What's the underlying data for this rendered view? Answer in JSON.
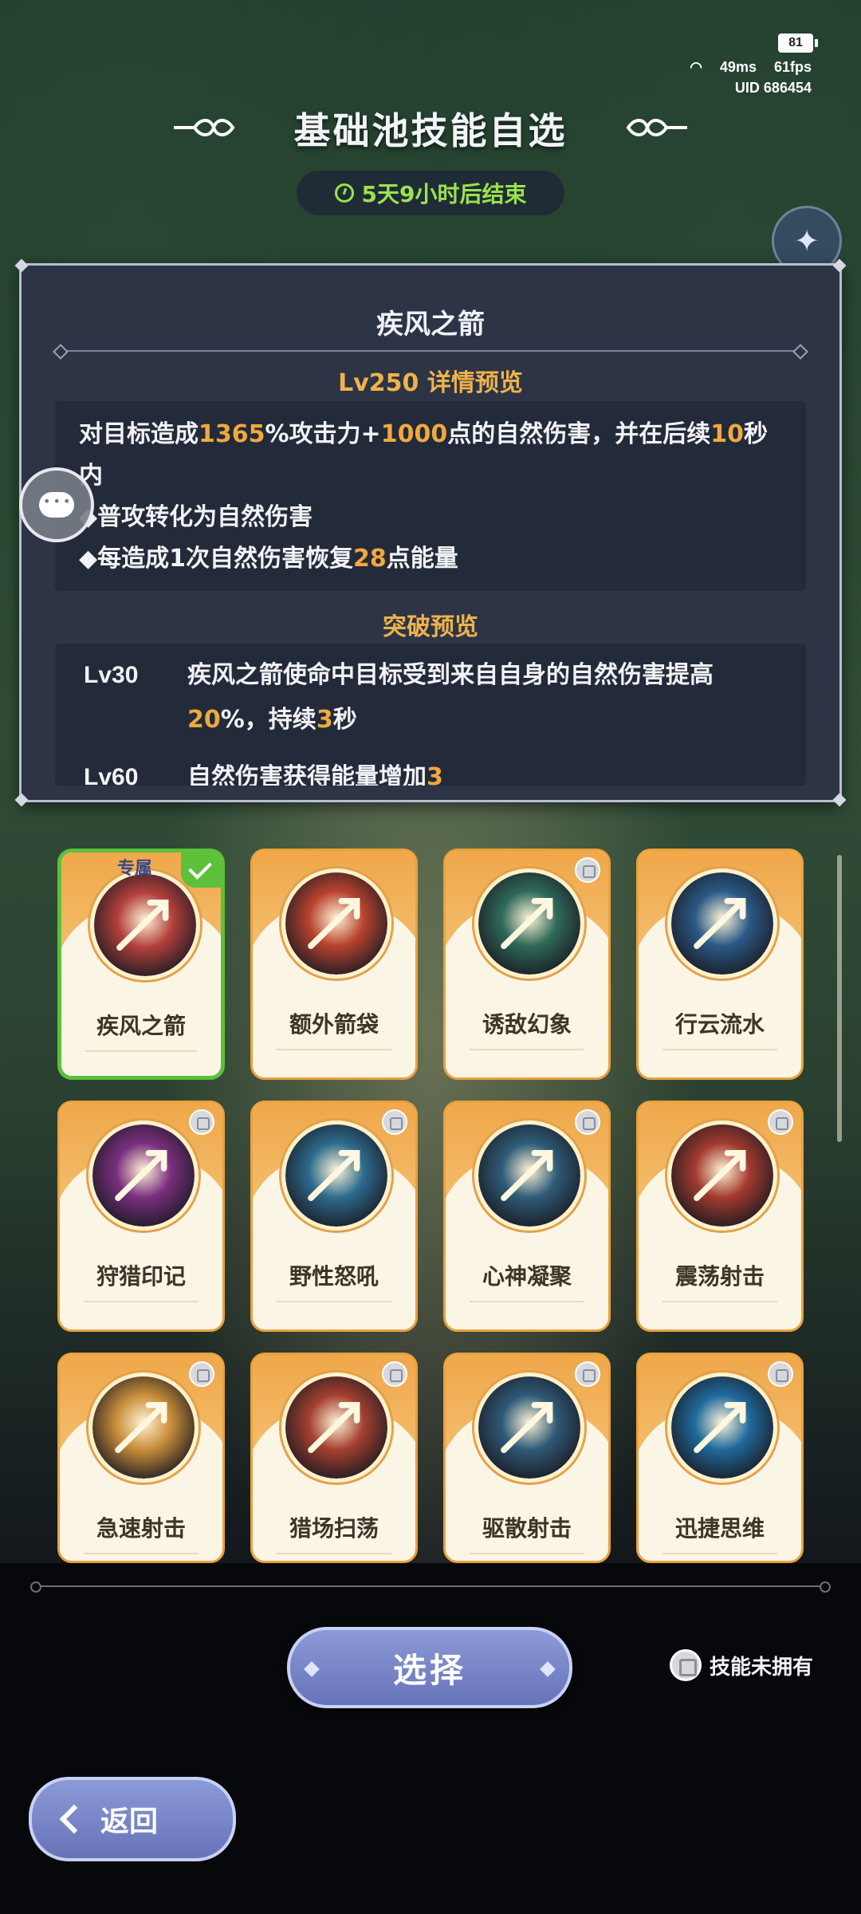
{
  "status": {
    "battery": "81",
    "ping": "49ms",
    "fps": "61fps",
    "uid": "UID 686454"
  },
  "header": {
    "title": "基础池技能自选",
    "timer": "5天9小时后结束"
  },
  "detail": {
    "skill_name": "疾风之箭",
    "preview_heading": "Lv250  详情预览",
    "desc_parts": [
      "对目标造成",
      "1365",
      "%攻击力+",
      "1000",
      "点的自然伤害，并在后续",
      "10",
      "秒内"
    ],
    "bullet_1": "◆普攻转化为自然伤害",
    "bullet_2_parts": [
      "◆每造成1次自然伤害恢复",
      "28",
      "点能量"
    ],
    "breakthrough_heading": "突破预览",
    "breakthroughs": [
      {
        "level": "Lv30",
        "parts": [
          "疾风之箭使命中目标受到来自自身的自然伤害提高",
          "20",
          "%，持续",
          "3",
          "秒"
        ]
      },
      {
        "level": "Lv60",
        "parts": [
          "自然伤害获得能量增加",
          "3",
          ""
        ]
      }
    ]
  },
  "skills": [
    {
      "name": "疾风之箭",
      "selected": true,
      "exclusive": "专属",
      "locked": false,
      "color": "#b3403c"
    },
    {
      "name": "额外箭袋",
      "selected": false,
      "locked": false,
      "color": "#b8432e"
    },
    {
      "name": "诱敌幻象",
      "selected": false,
      "locked": true,
      "color": "#2f6a5a"
    },
    {
      "name": "行云流水",
      "selected": false,
      "locked": false,
      "color": "#2a5a86"
    },
    {
      "name": "狩猎印记",
      "selected": false,
      "locked": true,
      "color": "#7a2f7e"
    },
    {
      "name": "野性怒吼",
      "selected": false,
      "locked": true,
      "color": "#2d6b8d"
    },
    {
      "name": "心神凝聚",
      "selected": false,
      "locked": true,
      "color": "#2e5c78"
    },
    {
      "name": "震荡射击",
      "selected": false,
      "locked": true,
      "color": "#a33a2e"
    },
    {
      "name": "急速射击",
      "selected": false,
      "locked": true,
      "color": "#c98e3a"
    },
    {
      "name": "猎场扫荡",
      "selected": false,
      "locked": true,
      "color": "#a4402f"
    },
    {
      "name": "驱散射击",
      "selected": false,
      "locked": true,
      "color": "#2f5a77"
    },
    {
      "name": "迅捷思维",
      "selected": false,
      "locked": true,
      "color": "#1f6a9c"
    }
  ],
  "actions": {
    "select_label": "选择",
    "legend_label": "技能未拥有",
    "back_label": "返回"
  }
}
